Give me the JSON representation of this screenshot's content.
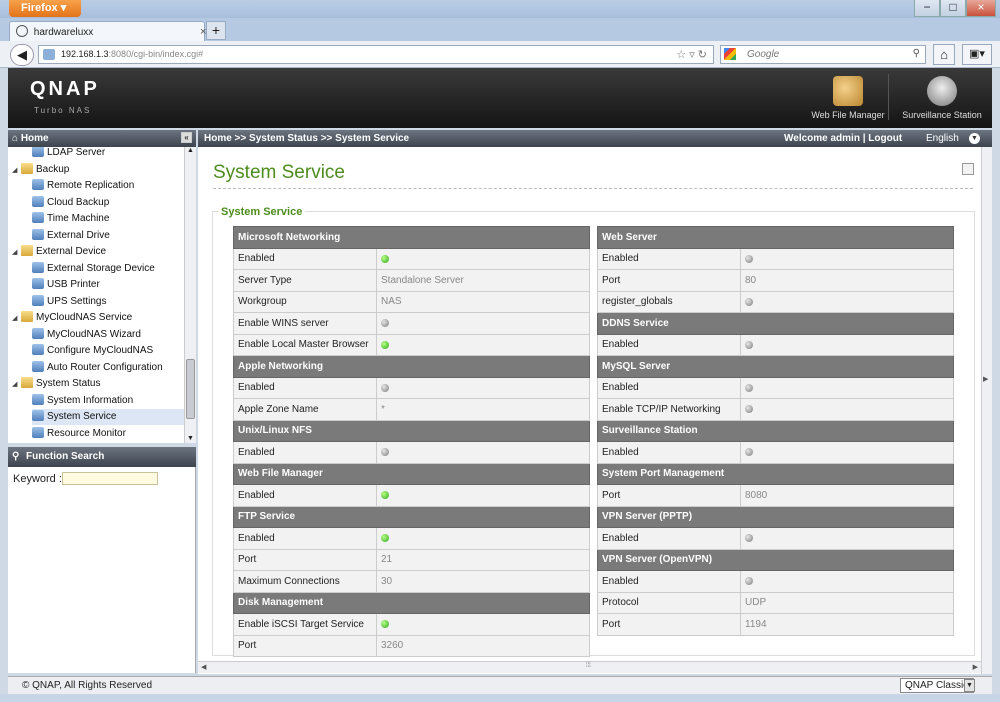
{
  "browser": {
    "firefox_label": "Firefox",
    "tab_title": "hardwareluxx",
    "tab_close": "×",
    "new_tab": "+",
    "url_host": "192.168.1.3",
    "url_path": ":8080/cgi-bin/index.cgi#",
    "search_placeholder": "Google",
    "minimize": "−",
    "maximize": "□",
    "close": "×"
  },
  "header": {
    "logo": "QNAP",
    "logo_sub": "Turbo NAS",
    "apps": [
      {
        "label": "Web File Manager",
        "icon": "web-file-manager-icon"
      },
      {
        "label": "Surveillance Station",
        "icon": "surveillance-station-icon"
      }
    ]
  },
  "sidebar": {
    "home": "Home",
    "collapse": "«",
    "items": [
      {
        "label": "LDAP Server",
        "level": 1,
        "type": "leaf"
      },
      {
        "label": "Backup",
        "level": 0,
        "type": "folder"
      },
      {
        "label": "Remote Replication",
        "level": 1,
        "type": "leaf"
      },
      {
        "label": "Cloud Backup",
        "level": 1,
        "type": "leaf"
      },
      {
        "label": "Time Machine",
        "level": 1,
        "type": "leaf"
      },
      {
        "label": "External Drive",
        "level": 1,
        "type": "leaf"
      },
      {
        "label": "External Device",
        "level": 0,
        "type": "folder"
      },
      {
        "label": "External Storage Device",
        "level": 1,
        "type": "leaf"
      },
      {
        "label": "USB Printer",
        "level": 1,
        "type": "leaf"
      },
      {
        "label": "UPS Settings",
        "level": 1,
        "type": "leaf"
      },
      {
        "label": "MyCloudNAS Service",
        "level": 0,
        "type": "folder"
      },
      {
        "label": "MyCloudNAS Wizard",
        "level": 1,
        "type": "leaf"
      },
      {
        "label": "Configure MyCloudNAS",
        "level": 1,
        "type": "leaf"
      },
      {
        "label": "Auto Router Configuration",
        "level": 1,
        "type": "leaf"
      },
      {
        "label": "System Status",
        "level": 0,
        "type": "folder"
      },
      {
        "label": "System Information",
        "level": 1,
        "type": "leaf"
      },
      {
        "label": "System Service",
        "level": 1,
        "type": "leaf",
        "selected": true
      },
      {
        "label": "Resource Monitor",
        "level": 1,
        "type": "leaf"
      }
    ]
  },
  "function_search": {
    "title": "Function Search",
    "keyword_label": "Keyword :"
  },
  "topbar": {
    "breadcrumb": "Home >> System Status >> System Service",
    "welcome": "Welcome admin | Logout",
    "language": "English"
  },
  "page": {
    "title": "System Service",
    "legend": "System Service"
  },
  "left_sections": [
    {
      "title": "Microsoft Networking",
      "rows": [
        {
          "label": "Enabled",
          "status": "on"
        },
        {
          "label": "Server Type",
          "value": "Standalone Server"
        },
        {
          "label": "Workgroup",
          "value": "NAS"
        },
        {
          "label": "Enable WINS server",
          "status": "off"
        },
        {
          "label": "Enable Local Master Browser",
          "status": "on"
        }
      ]
    },
    {
      "title": "Apple Networking",
      "rows": [
        {
          "label": "Enabled",
          "status": "off"
        },
        {
          "label": "Apple Zone Name",
          "value": "*"
        }
      ]
    },
    {
      "title": "Unix/Linux NFS",
      "rows": [
        {
          "label": "Enabled",
          "status": "off"
        }
      ]
    },
    {
      "title": "Web File Manager",
      "rows": [
        {
          "label": "Enabled",
          "status": "on"
        }
      ]
    },
    {
      "title": "FTP Service",
      "rows": [
        {
          "label": "Enabled",
          "status": "on"
        },
        {
          "label": "Port",
          "value": "21"
        },
        {
          "label": "Maximum Connections",
          "value": "30"
        }
      ]
    },
    {
      "title": "Disk Management",
      "rows": [
        {
          "label": "Enable iSCSI Target Service",
          "status": "on"
        },
        {
          "label": "Port",
          "value": "3260"
        }
      ]
    }
  ],
  "right_sections": [
    {
      "title": "Web Server",
      "rows": [
        {
          "label": "Enabled",
          "status": "off"
        },
        {
          "label": "Port",
          "value": "80"
        },
        {
          "label": "register_globals",
          "status": "off"
        }
      ]
    },
    {
      "title": "DDNS Service",
      "rows": [
        {
          "label": "Enabled",
          "status": "off"
        }
      ]
    },
    {
      "title": "MySQL Server",
      "rows": [
        {
          "label": "Enabled",
          "status": "off"
        },
        {
          "label": "Enable TCP/IP Networking",
          "status": "off"
        }
      ]
    },
    {
      "title": "Surveillance Station",
      "rows": [
        {
          "label": "Enabled",
          "status": "off"
        }
      ]
    },
    {
      "title": "System Port Management",
      "rows": [
        {
          "label": "Port",
          "value": "8080"
        }
      ]
    },
    {
      "title": "VPN Server (PPTP)",
      "rows": [
        {
          "label": "Enabled",
          "status": "off"
        }
      ]
    },
    {
      "title": "VPN Server (OpenVPN)",
      "rows": [
        {
          "label": "Enabled",
          "status": "off"
        },
        {
          "label": "Protocol",
          "value": "UDP"
        },
        {
          "label": "Port",
          "value": "1194"
        }
      ]
    }
  ],
  "footer": {
    "copyright": "© QNAP, All Rights Reserved",
    "theme": "QNAP Classic"
  },
  "colors": {
    "accent": "#4e8c1d",
    "section_header": "#7a7a7a",
    "enabled": "#2fa71a",
    "disabled": "#7c7c7c"
  }
}
